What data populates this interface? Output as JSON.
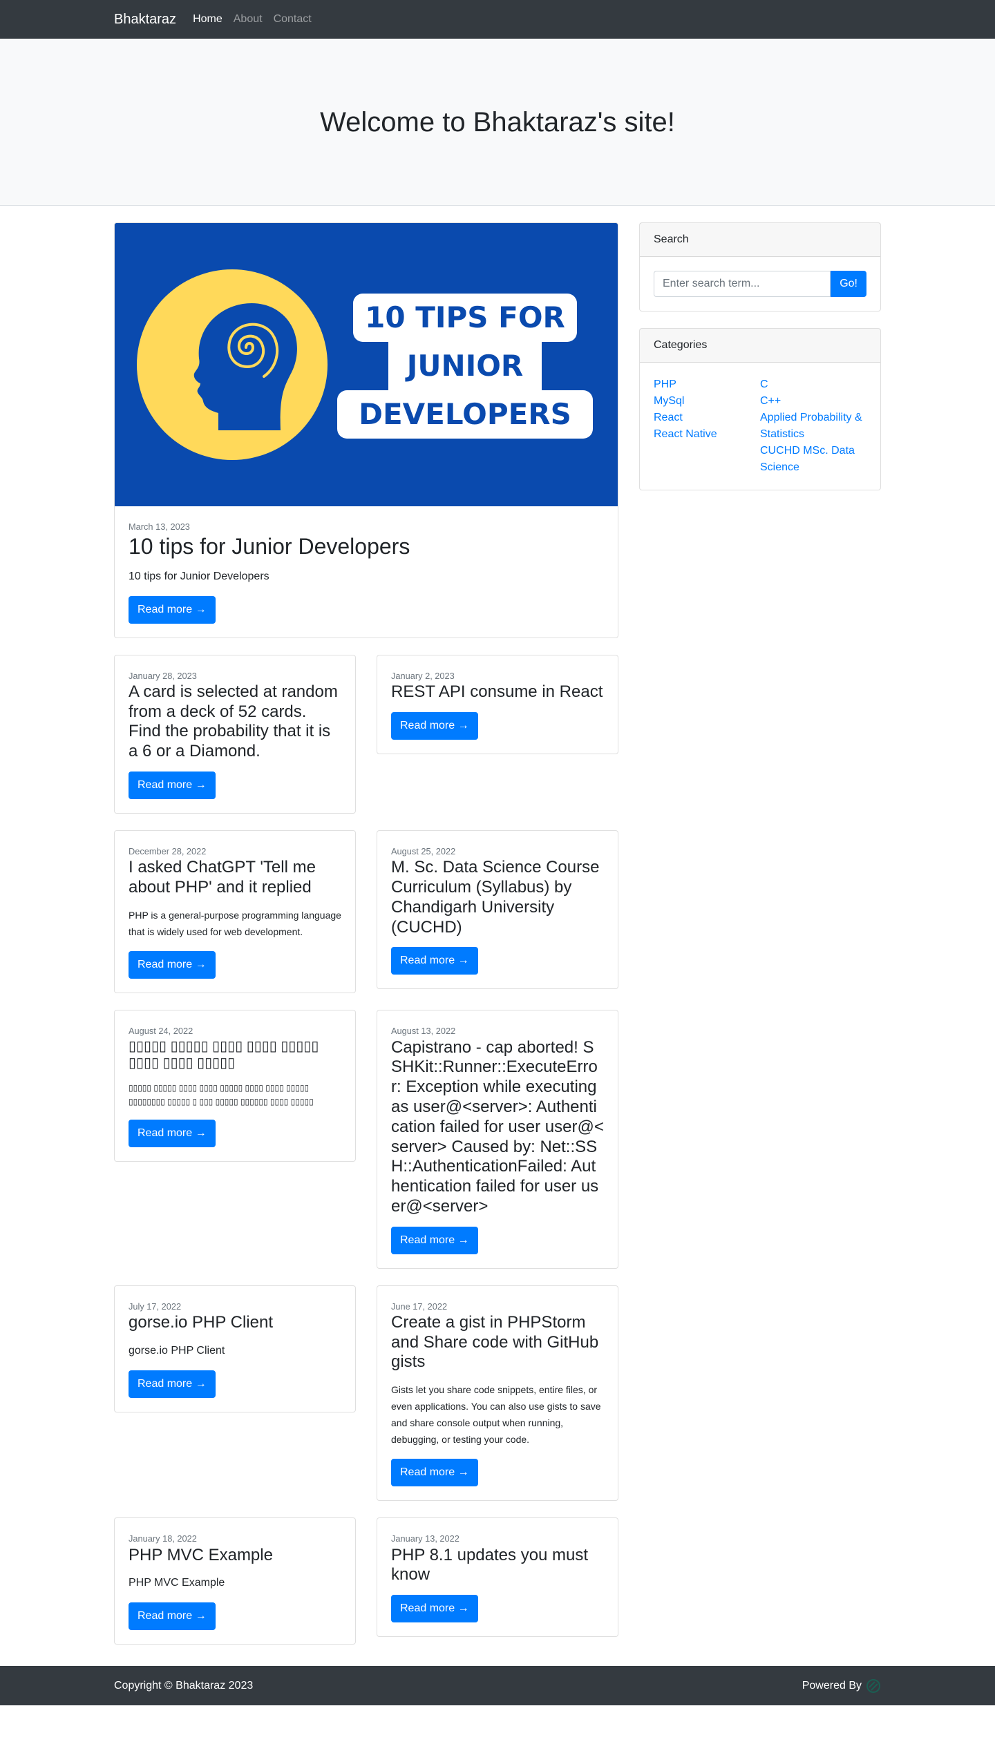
{
  "navbar": {
    "brand": "Bhaktaraz",
    "links": [
      "Home",
      "About",
      "Contact"
    ]
  },
  "hero": {
    "title": "Welcome to Bhaktaraz's site!"
  },
  "featured": {
    "image_text": [
      "10 TIPS FOR",
      "JUNIOR",
      "DEVELOPERS"
    ],
    "date": "March 13, 2023",
    "title": "10 tips for Junior Developers",
    "excerpt": "10 tips for Junior Developers",
    "button": "Read more →"
  },
  "posts": [
    {
      "date": "January 28, 2023",
      "title": "A card is selected at random from a deck of 52 cards. Find the probability that it is a 6 or a Diamond.",
      "excerpt": "",
      "button": "Read more →"
    },
    {
      "date": "January 2, 2023",
      "title": "REST API consume in React",
      "excerpt": "",
      "button": "Read more →"
    },
    {
      "date": "December 28, 2022",
      "title": "I asked ChatGPT 'Tell me about PHP' and it replied",
      "excerpt": "PHP is a general-purpose programming language that is widely used for web development.",
      "button": "Read more →"
    },
    {
      "date": "August 25, 2022",
      "title": "M. Sc. Data Science Course Curriculum (Syllabus) by Chandigarh University (CUCHD)",
      "excerpt": "",
      "button": "Read more →"
    },
    {
      "date": "August 24, 2022",
      "title": "▯▯▯▯▯ ▯▯▯▯▯ ▯▯▯▯ ▯▯▯▯ ▯▯▯▯▯ ▯▯▯▯ ▯▯▯▯ ▯▯▯▯▯",
      "excerpt": "▯▯▯▯▯ ▯▯▯▯▯ ▯▯▯▯ ▯▯▯▯ ▯▯▯▯▯ ▯▯▯▯ ▯▯▯▯ ▯▯▯▯▯ ▯▯▯▯▯▯▯▯ ▯▯▯▯▯ ▯ ▯▯▯ ▯▯▯▯▯ ▯▯▯▯▯▯ ▯▯▯▯ ▯▯▯▯▯",
      "button": "Read more →"
    },
    {
      "date": "August 13, 2022",
      "title": "Capistrano - cap aborted! SSHKit::Runner::ExecuteError: Exception while executing as user@<server>: Authentication failed for user user@<server> Caused by: Net::SSH::AuthenticationFailed: Authentication failed for user user@<server>",
      "excerpt": "",
      "button": "Read more →"
    },
    {
      "date": "July 17, 2022",
      "title": "gorse.io PHP Client",
      "excerpt": "gorse.io PHP Client",
      "button": "Read more →"
    },
    {
      "date": "June 17, 2022",
      "title": "Create a gist in PHPStorm and Share code with GitHub gists",
      "excerpt": "Gists let you share code snippets, entire files, or even applications. You can also use gists to save and share console output when running, debugging, or testing your code.",
      "button": "Read more →"
    },
    {
      "date": "January 18, 2022",
      "title": "PHP MVC Example",
      "excerpt": "PHP MVC Example",
      "button": "Read more →"
    },
    {
      "date": "January 13, 2022",
      "title": "PHP 8.1 updates you must know",
      "excerpt": "",
      "button": "Read more →"
    }
  ],
  "sidebar": {
    "search": {
      "header": "Search",
      "placeholder": "Enter search term...",
      "button": "Go!"
    },
    "categories": {
      "header": "Categories",
      "left": [
        "PHP",
        "MySql",
        "React",
        "React Native"
      ],
      "right": [
        "C",
        "C++",
        "Applied Probability & Statistics",
        "CUCHD MSc. Data Science"
      ]
    }
  },
  "footer": {
    "copyright": "Copyright © Bhaktaraz 2023",
    "powered": "Powered By"
  },
  "colors": {
    "primary": "#007bff",
    "dark": "#343a40",
    "featured_bg": "#0a4aae",
    "featured_circle": "#ffd95a"
  }
}
